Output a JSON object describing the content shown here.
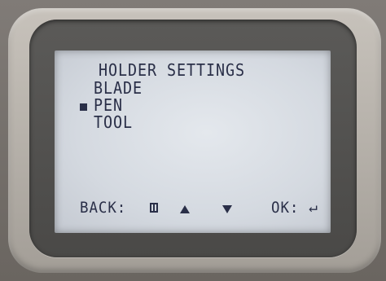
{
  "screen": {
    "title": "HOLDER SETTINGS",
    "menu": [
      {
        "label": "BLADE",
        "selected": false
      },
      {
        "label": "PEN",
        "selected": true
      },
      {
        "label": "TOOL",
        "selected": false
      }
    ]
  },
  "footer": {
    "back_label": "BACK:",
    "back_icon": "back-key-icon",
    "up_icon": "up-arrow-icon",
    "down_icon": "down-arrow-icon",
    "ok_label": "OK:",
    "ok_icon": "enter-icon",
    "ok_symbol": "↵"
  },
  "colors": {
    "lcd_background": "#d8dde4",
    "lcd_text": "#2a2f48",
    "bezel": "#bdb8b1"
  }
}
